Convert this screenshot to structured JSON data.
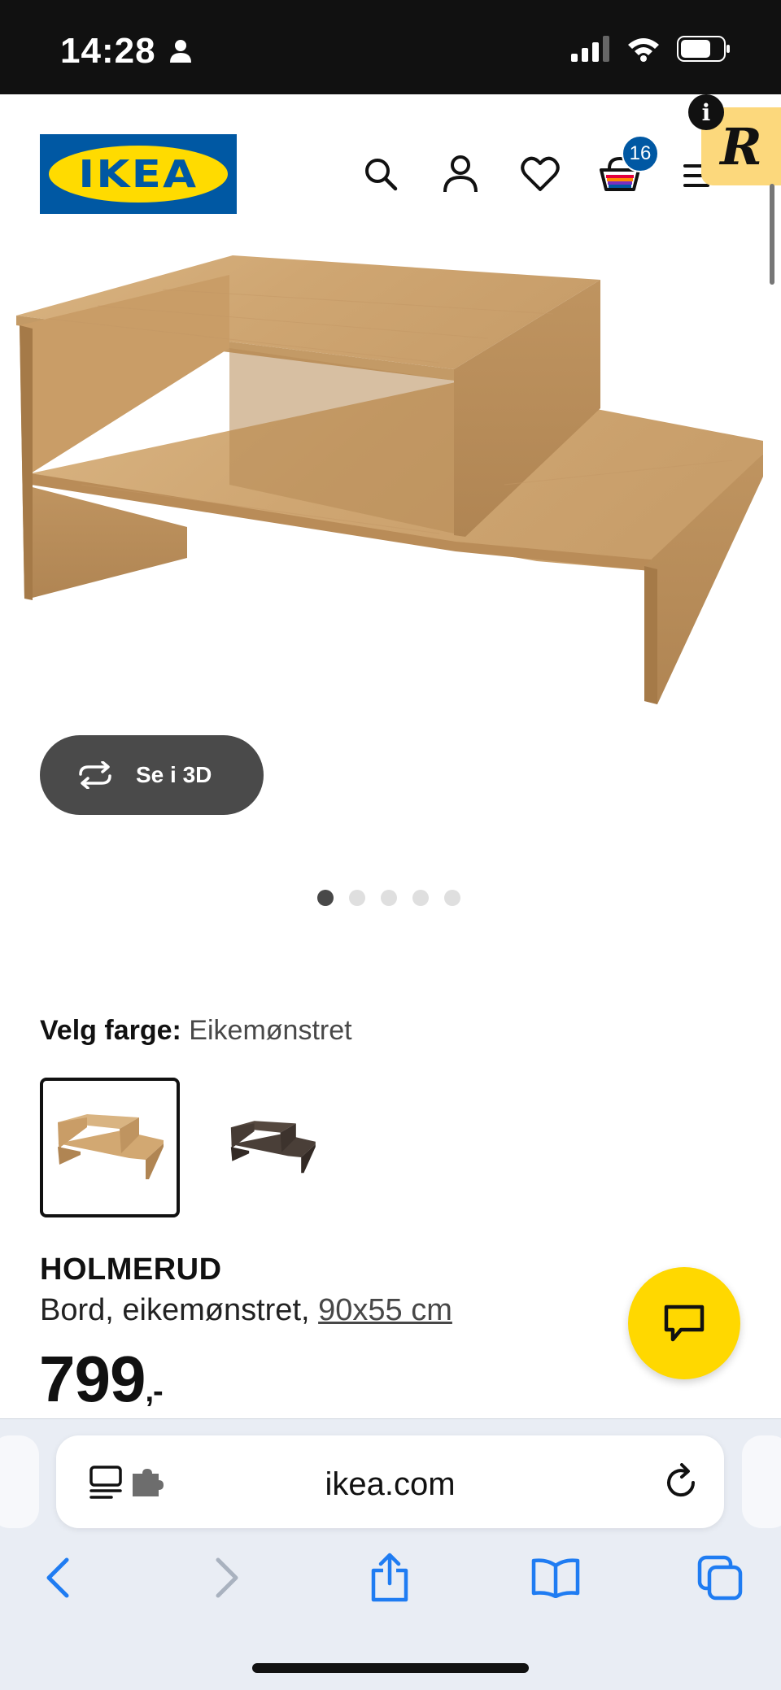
{
  "status_bar": {
    "time": "14:28"
  },
  "header": {
    "logo_text": "IKEA",
    "cart_count": "16",
    "info_glyph": "i",
    "extension_glyph": "R",
    "icons": [
      "search-icon",
      "account-icon",
      "heart-icon",
      "cart-icon",
      "menu-icon"
    ]
  },
  "gallery": {
    "view_3d_label": "Se i 3D",
    "dot_count": 5,
    "active_dot": 0
  },
  "color_picker": {
    "label": "Velg farge:",
    "selected": "Eikemønstret"
  },
  "product": {
    "name": "HOLMERUD",
    "description": "Bord, eikemønstret,",
    "size_link": "90x55 cm",
    "price": "799",
    "price_suffix": ",-"
  },
  "browser": {
    "url": "ikea.com"
  },
  "colors": {
    "ikea_blue": "#0058a3",
    "ikea_yellow": "#ffdb00",
    "chat_yellow": "#ffd800",
    "safari_blue": "#1f7cf2"
  }
}
